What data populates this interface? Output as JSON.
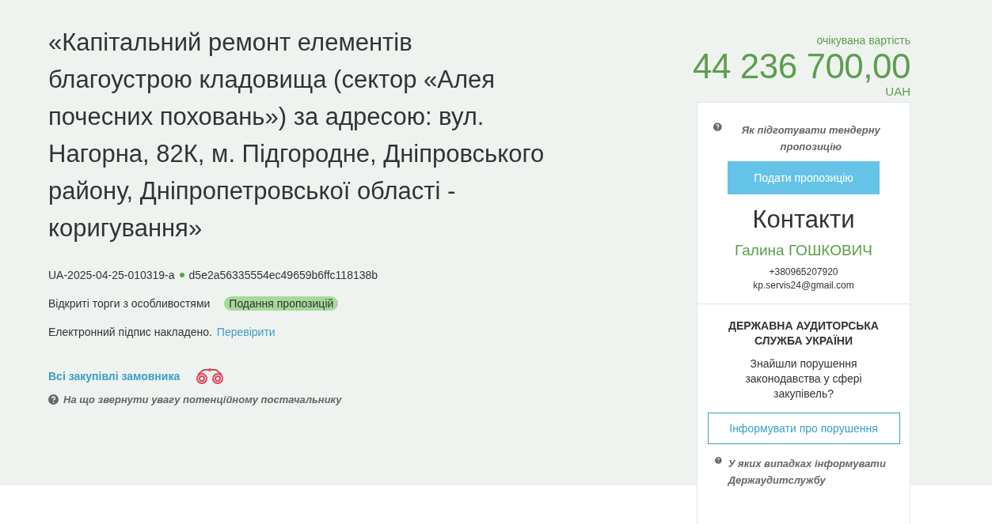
{
  "tender": {
    "title": "«Капітальний ремонт елементів благоустрою кладовища (сектор «Алея почесних поховань») за адресою: вул. Нагорна, 82К, м. Підгородне, Дніпровського району, Дніпропетровської області - коригування»",
    "id": "UA-2025-04-25-010319-a",
    "hash": "d5e2a56335554ec49659b6ffc118138b",
    "procedure": "Відкриті торги з особливостями",
    "status": "Подання пропозицій",
    "signature": "Електронний підпис накладено.",
    "verify_link": "Перевірити",
    "buyer_link": "Всі закупівлі замовника",
    "help_link": "На що звернути увагу потенційному постачальнику"
  },
  "price": {
    "label": "очікувана вартість",
    "amount": "44 236 700,00",
    "currency": "UAH"
  },
  "sidebar": {
    "help_link": "Як підготувати тендерну пропозицію",
    "submit_button": "Подати пропозицію",
    "contacts": {
      "heading": "Контакти",
      "name": "Галина ГОШКОВИЧ",
      "phone": "+380965207920",
      "email": "kp.servis24@gmail.com"
    },
    "audit": {
      "heading": "ДЕРЖАВНА АУДИТОРСЬКА СЛУЖБА УКРАЇНИ",
      "question": "Знайшли порушення законодавства у сфері закупівель?",
      "report_button": "Інформувати про порушення",
      "help_link": "У яких випадках інформувати Держаудитслужбу"
    }
  }
}
